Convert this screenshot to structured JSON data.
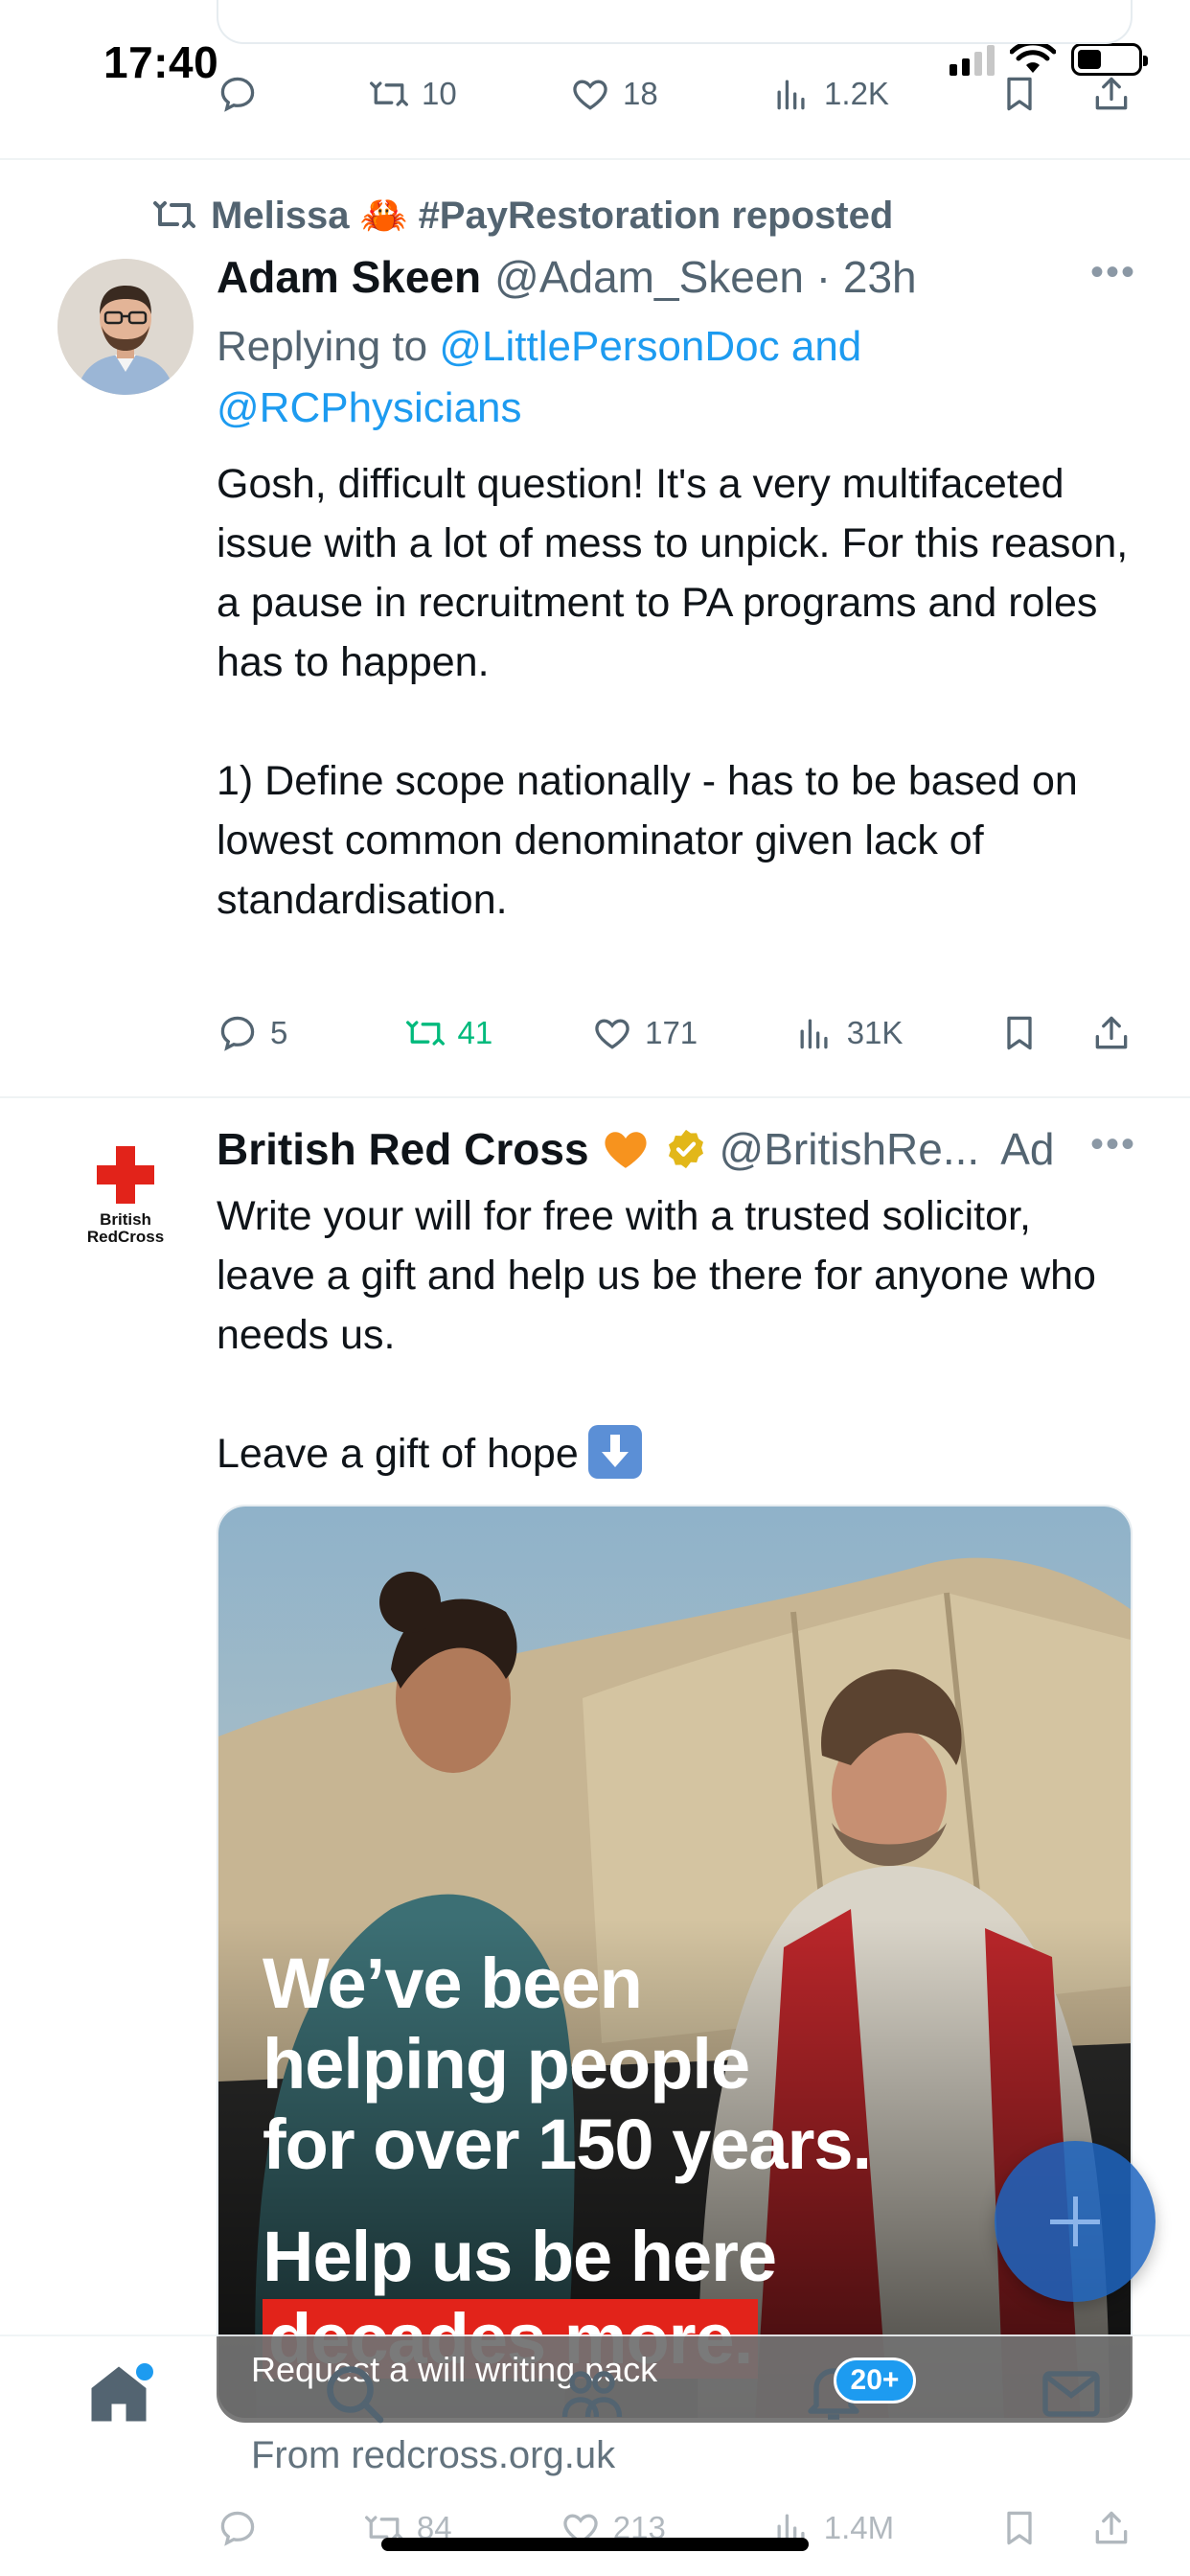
{
  "status_bar": {
    "time": "17:40"
  },
  "prev_tweet": {
    "actions": {
      "reply": "",
      "retweet": "10",
      "like": "18",
      "views": "1.2K"
    }
  },
  "tweet1": {
    "repost_by": "Melissa 🦀 #PayRestoration reposted",
    "name": "Adam Skeen",
    "handle": "@Adam_Skeen · 23h",
    "replying_prefix": "Replying to ",
    "replying_links": "@LittlePersonDoc and @RCPhysicians",
    "text": "Gosh, difficult question! It's a very multifaceted issue with a lot of mess to unpick. For this reason, a pause in recruitment to PA programs and roles has to happen.\n\n1) Define scope nationally - has to be based on lowest common denominator given lack of standardisation.",
    "actions": {
      "reply": "5",
      "retweet": "41",
      "like": "171",
      "views": "31K"
    }
  },
  "ad_tweet": {
    "logo_text": "British\nRedCross",
    "name": "British Red Cross",
    "handle": "@BritishRe...",
    "ad_label": "Ad",
    "text": "Write your will for free with a trusted solicitor, leave a gift and help us be there for anyone who needs us.\n\nLeave a gift of hope",
    "image_headline": "We’ve been\nhelping people\nfor over 150 years.",
    "image_help_line": "Help us be here",
    "image_help_red": "decades more.",
    "cta": "Request a will writing pack",
    "from": "From redcross.org.uk",
    "actions": {
      "retweet": "84",
      "like": "213",
      "views": "1.4M"
    }
  },
  "nav": {
    "notifications_badge": "20+"
  },
  "colors": {
    "accent": "#1d9bf0",
    "retweet_green": "#00ba7c",
    "muted": "#536471",
    "red_cross": "#e2231a"
  },
  "icons": [
    "reply-icon",
    "retweet-icon",
    "like-icon",
    "views-icon",
    "bookmark-icon",
    "share-icon",
    "more-icon",
    "verified-icon",
    "home-icon",
    "search-icon",
    "communities-icon",
    "notifications-icon",
    "messages-icon",
    "compose-icon"
  ]
}
